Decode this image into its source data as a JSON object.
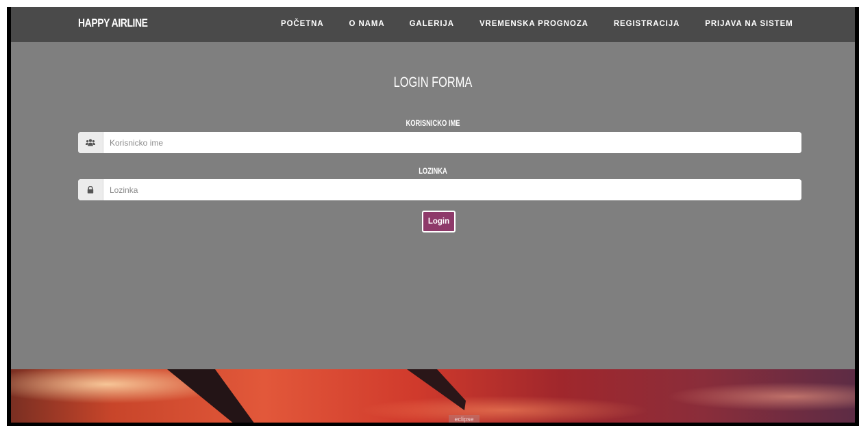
{
  "navbar": {
    "brand": "HAPPY AIRLINE",
    "links": [
      "POČETNA",
      "O NAMA",
      "GALERIJA",
      "VREMENSKA PROGNOZA",
      "REGISTRACIJA",
      "PRIJAVA NA SISTEM"
    ]
  },
  "login_form": {
    "title": "LOGIN FORMA",
    "username": {
      "label": "KORISNICKO IME",
      "placeholder": "Korisnicko ime",
      "value": "",
      "icon": "users-icon"
    },
    "password": {
      "label": "LOZINKA",
      "placeholder": "Lozinka",
      "value": "",
      "icon": "lock-icon"
    },
    "submit_label": "Login"
  },
  "hero": {
    "caption": "eclipse"
  },
  "colors": {
    "navbar_bg": "#4a4a4a",
    "page_bg": "#7f7f7f",
    "button_bg": "#8e3a6a",
    "text": "#ffffff"
  }
}
